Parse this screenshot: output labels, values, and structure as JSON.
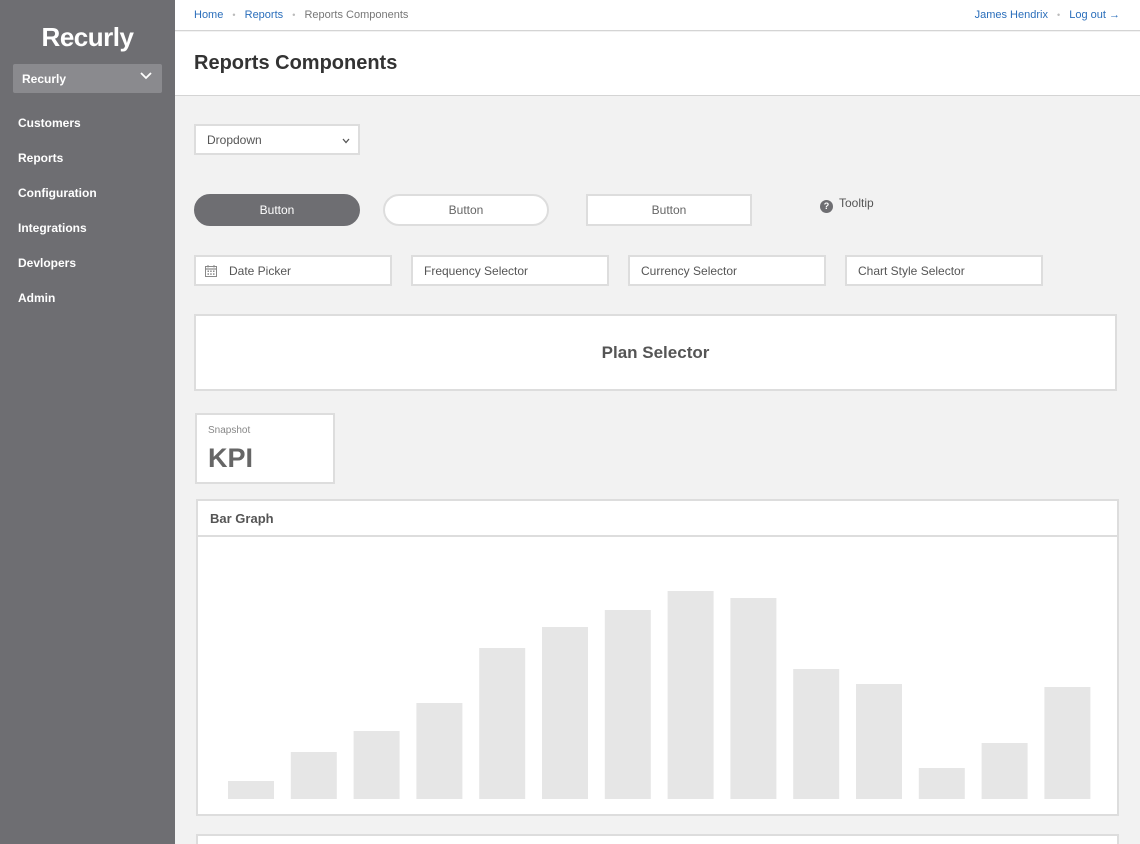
{
  "sidebar": {
    "logo": "Recurly",
    "account": "Recurly",
    "items": [
      {
        "label": "Customers"
      },
      {
        "label": "Reports"
      },
      {
        "label": "Configuration"
      },
      {
        "label": "Integrations"
      },
      {
        "label": "Devlopers"
      },
      {
        "label": "Admin"
      }
    ]
  },
  "topbar": {
    "breadcrumbs": [
      "Home",
      "Reports",
      "Reports Components"
    ],
    "user_name": "James Hendrix",
    "logout": "Log out →"
  },
  "page": {
    "title": "Reports Components"
  },
  "controls": {
    "dropdown": "Dropdown",
    "buttons": [
      "Button",
      "Button",
      "Button"
    ],
    "tooltip": "Tooltip",
    "fields": [
      "Date Picker",
      "Frequency Selector",
      "Currency Selector",
      "Chart Style Selector"
    ],
    "plan_selector": "Plan Selector"
  },
  "kpi": {
    "label": "Snapshot",
    "value": "KPI"
  },
  "graph": {
    "title": "Bar Graph"
  },
  "colors": {
    "sidebar": "#6e6e72",
    "link": "#2a6ebb",
    "bar": "#e6e6e6",
    "border": "#dddddd"
  },
  "chart_data": {
    "type": "bar",
    "values": [
      18,
      47,
      68,
      96,
      151,
      172,
      189,
      208,
      201,
      130,
      115,
      31,
      56,
      112
    ],
    "ylim": [
      0,
      225
    ]
  }
}
